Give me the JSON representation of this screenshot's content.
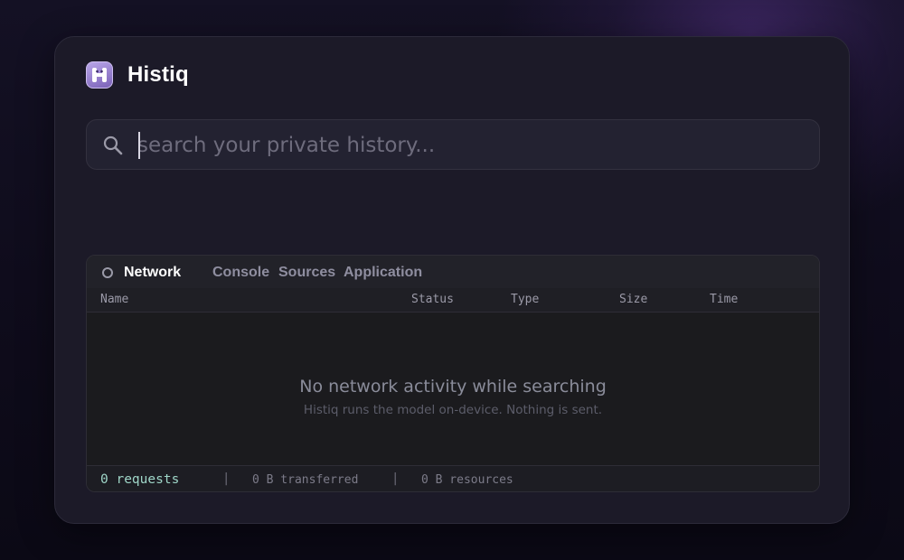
{
  "app": {
    "name": "Histiq",
    "logo_icon": "histiq-logo-icon"
  },
  "search": {
    "placeholder": "search your private history...",
    "value": "",
    "icon": "search-icon"
  },
  "devtools": {
    "tabs": [
      {
        "label": "Network",
        "active": true
      },
      {
        "label": "Console",
        "active": false
      },
      {
        "label": "Sources",
        "active": false
      },
      {
        "label": "Application",
        "active": false
      }
    ],
    "columns": [
      "Name",
      "Status",
      "Type",
      "Size",
      "Time"
    ],
    "empty_state": {
      "title": "No network activity while searching",
      "subtitle": "Histiq runs the model on-device. Nothing is sent."
    },
    "footer": {
      "requests": "0 requests",
      "transferred": "0 B transferred",
      "resources": "0 B resources",
      "separator": "|"
    }
  },
  "colors": {
    "background": "#0e0b18",
    "card": "#1c1a28",
    "accent_glow": "#58348c",
    "requests_text": "#9fd6c8"
  }
}
